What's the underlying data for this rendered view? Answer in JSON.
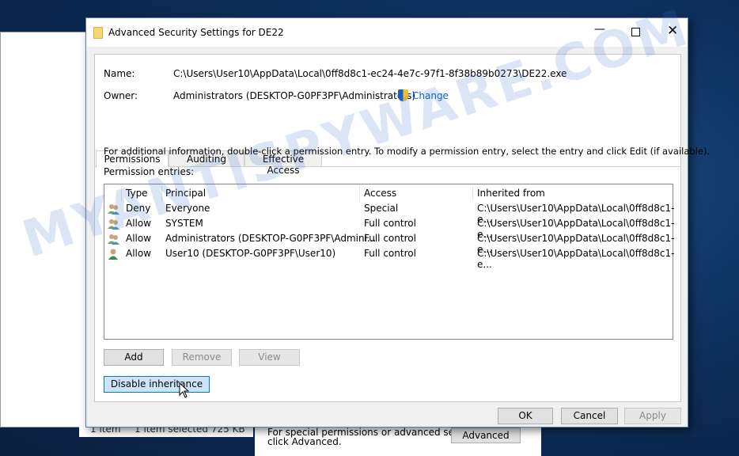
{
  "dialog": {
    "title": "Advanced Security Settings for DE22",
    "name_label": "Name:",
    "name_value": "C:\\Users\\User10\\AppData\\Local\\0ff8d8c1-ec24-4e7c-97f1-8f38b89b0273\\DE22.exe",
    "owner_label": "Owner:",
    "owner_value": "Administrators (DESKTOP-G0PF3PF\\Administrators)",
    "change_link": "Change",
    "tabs": [
      {
        "label": "Permissions"
      },
      {
        "label": "Auditing"
      },
      {
        "label": "Effective Access"
      }
    ],
    "info_text": "For additional information, double-click a permission entry. To modify a permission entry, select the entry and click Edit (if available).",
    "entries_label": "Permission entries:",
    "columns": [
      "Type",
      "Principal",
      "Access",
      "Inherited from"
    ],
    "rows": [
      {
        "icon": "group-users-icon",
        "type": "Deny",
        "principal": "Everyone",
        "access": "Special",
        "inherited": "C:\\Users\\User10\\AppData\\Local\\0ff8d8c1-e..."
      },
      {
        "icon": "group-users-icon",
        "type": "Allow",
        "principal": "SYSTEM",
        "access": "Full control",
        "inherited": "C:\\Users\\User10\\AppData\\Local\\0ff8d8c1-e..."
      },
      {
        "icon": "group-users-icon",
        "type": "Allow",
        "principal": "Administrators (DESKTOP-G0PF3PF\\Admini...",
        "access": "Full control",
        "inherited": "C:\\Users\\User10\\AppData\\Local\\0ff8d8c1-e..."
      },
      {
        "icon": "user-icon",
        "type": "Allow",
        "principal": "User10 (DESKTOP-G0PF3PF\\User10)",
        "access": "Full control",
        "inherited": "C:\\Users\\User10\\AppData\\Local\\0ff8d8c1-e..."
      }
    ],
    "buttons": {
      "add": "Add",
      "remove": "Remove",
      "view": "View",
      "disable_inheritance": "Disable inheritance",
      "ok": "OK",
      "cancel": "Cancel",
      "apply": "Apply"
    }
  },
  "background": {
    "status_left": "1 item",
    "status_sel": "1 item selected  725 KB",
    "adv_text1": "For special permissions or advanced settings,",
    "adv_text2": "click Advanced.",
    "adv_button": "Advanced"
  },
  "watermark": "MYANTISPYWARE.COM",
  "colors": {
    "link": "#0066cc",
    "selected_button": "#cce4f7",
    "selected_border": "#0078d7"
  }
}
